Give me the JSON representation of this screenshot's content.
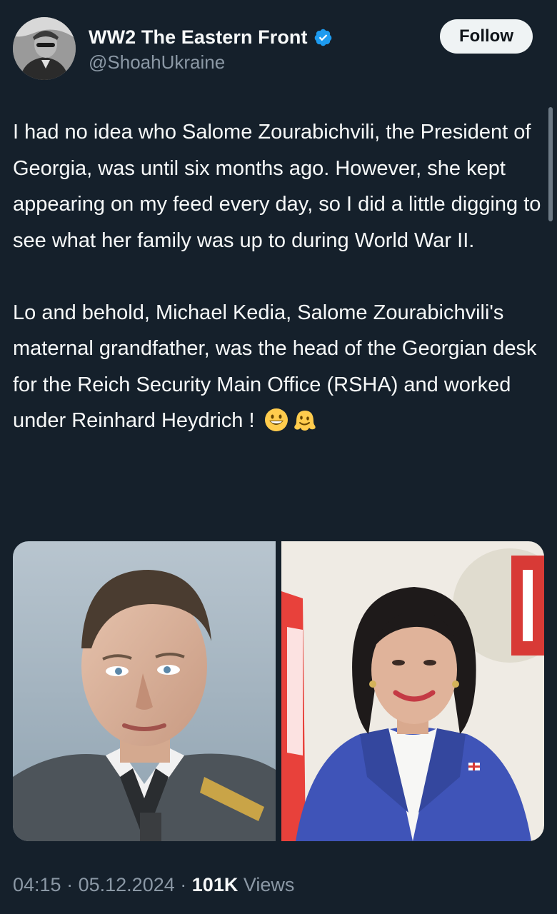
{
  "header": {
    "display_name": "WW2 The Eastern Front",
    "handle": "@ShoahUkraine",
    "follow_label": "Follow",
    "verified_icon": "verified-badge-icon",
    "verified_color": "#1d9bf0"
  },
  "tweet": {
    "paragraph_1": "I had no idea who Salome Zourabichvili, the President of Georgia, was until six months ago. However, she kept appearing on my feed every day, so I did a little digging to see what her family was up to during World War II.",
    "paragraph_2": "Lo and behold, Michael Kedia, Salome Zourabichvili's maternal grandfather, was the head of the Georgian desk for the Reich Security Main Office (RSHA) and worked under Reinhard Heydrich ! ",
    "emojis": [
      "grinning-face-emoji",
      "melting-face-emoji"
    ]
  },
  "media": {
    "images": [
      "portrait-man-in-uniform",
      "portrait-woman-in-blue-jacket"
    ]
  },
  "meta": {
    "time": "04:15",
    "separator": "·",
    "date": "05.12.2024",
    "views_count": "101K",
    "views_label": "Views"
  },
  "colors": {
    "background": "#15202b",
    "text_primary": "#f7f9f9",
    "text_secondary": "#8b98a5",
    "follow_bg": "#eff3f4"
  }
}
